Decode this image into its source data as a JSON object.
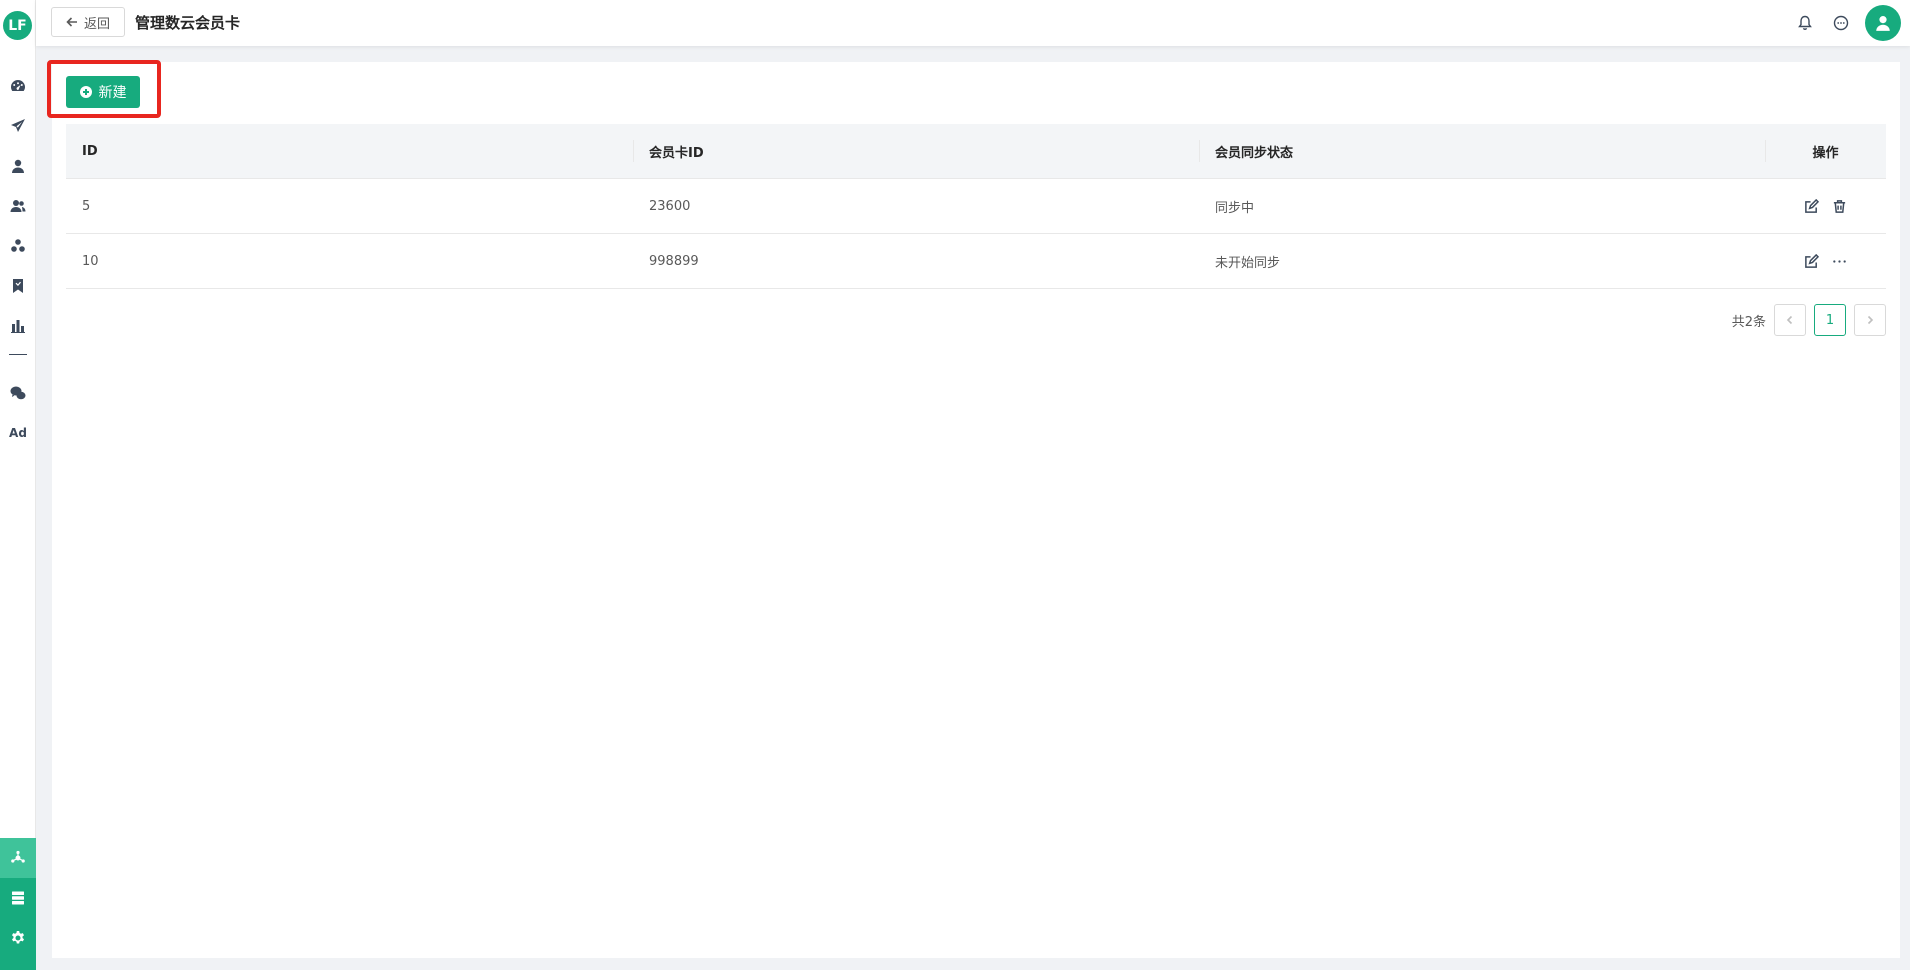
{
  "app": {
    "logo_text": "LF",
    "brand_color": "#17ab7e",
    "highlight_color": "#e8261f"
  },
  "sidebar": {
    "items": [
      {
        "name": "dashboard-icon"
      },
      {
        "name": "send-icon"
      },
      {
        "name": "user-icon"
      },
      {
        "name": "users-icon"
      },
      {
        "name": "group-icon"
      },
      {
        "name": "bookmark-icon"
      },
      {
        "name": "bar-chart-icon"
      },
      {
        "name": "wechat-icon"
      }
    ],
    "ad_label": "Ad",
    "bottom_items": [
      {
        "name": "network-icon",
        "active": true
      },
      {
        "name": "server-icon"
      },
      {
        "name": "settings-icon"
      }
    ]
  },
  "header": {
    "back_label": "返回",
    "title": "管理数云会员卡",
    "icons": [
      "bell-icon",
      "chat-icon",
      "avatar-icon"
    ]
  },
  "toolbar": {
    "new_label": "新建"
  },
  "table": {
    "columns": [
      "ID",
      "会员卡ID",
      "会员同步状态",
      "操作"
    ],
    "rows": [
      {
        "id": "5",
        "card_id": "23600",
        "status": "同步中",
        "actions": [
          "edit-icon",
          "delete-icon"
        ]
      },
      {
        "id": "10",
        "card_id": "998899",
        "status": "未开始同步",
        "actions": [
          "edit-icon",
          "more-icon"
        ]
      }
    ]
  },
  "pagination": {
    "total_text": "共2条",
    "current_page": "1"
  }
}
